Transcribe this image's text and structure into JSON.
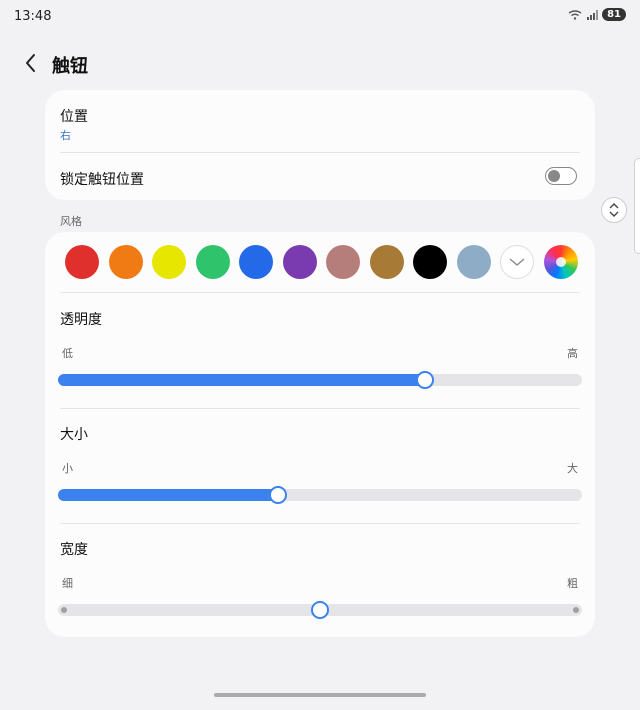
{
  "status_bar": {
    "time": "13:48",
    "battery": "81"
  },
  "header": {
    "title": "触钮"
  },
  "position": {
    "label": "位置",
    "value": "右"
  },
  "lock": {
    "label": "锁定触钮位置",
    "on": false
  },
  "style": {
    "label": "风格",
    "colors": [
      "#e0302e",
      "#f07b14",
      "#e6e600",
      "#2fc46b",
      "#2469e8",
      "#7b3bb0",
      "#b67e7a",
      "#a77a35",
      "#000000",
      "#8facc6"
    ],
    "selected": "custom-white",
    "rainbow_picker": true
  },
  "opacity": {
    "title": "透明度",
    "low": "低",
    "high": "高",
    "value_percent": 70
  },
  "size": {
    "title": "大小",
    "low": "小",
    "high": "大",
    "value_percent": 42
  },
  "width": {
    "title": "宽度",
    "low": "细",
    "high": "粗",
    "value_percent": 50
  },
  "accent": "#3b82ee"
}
